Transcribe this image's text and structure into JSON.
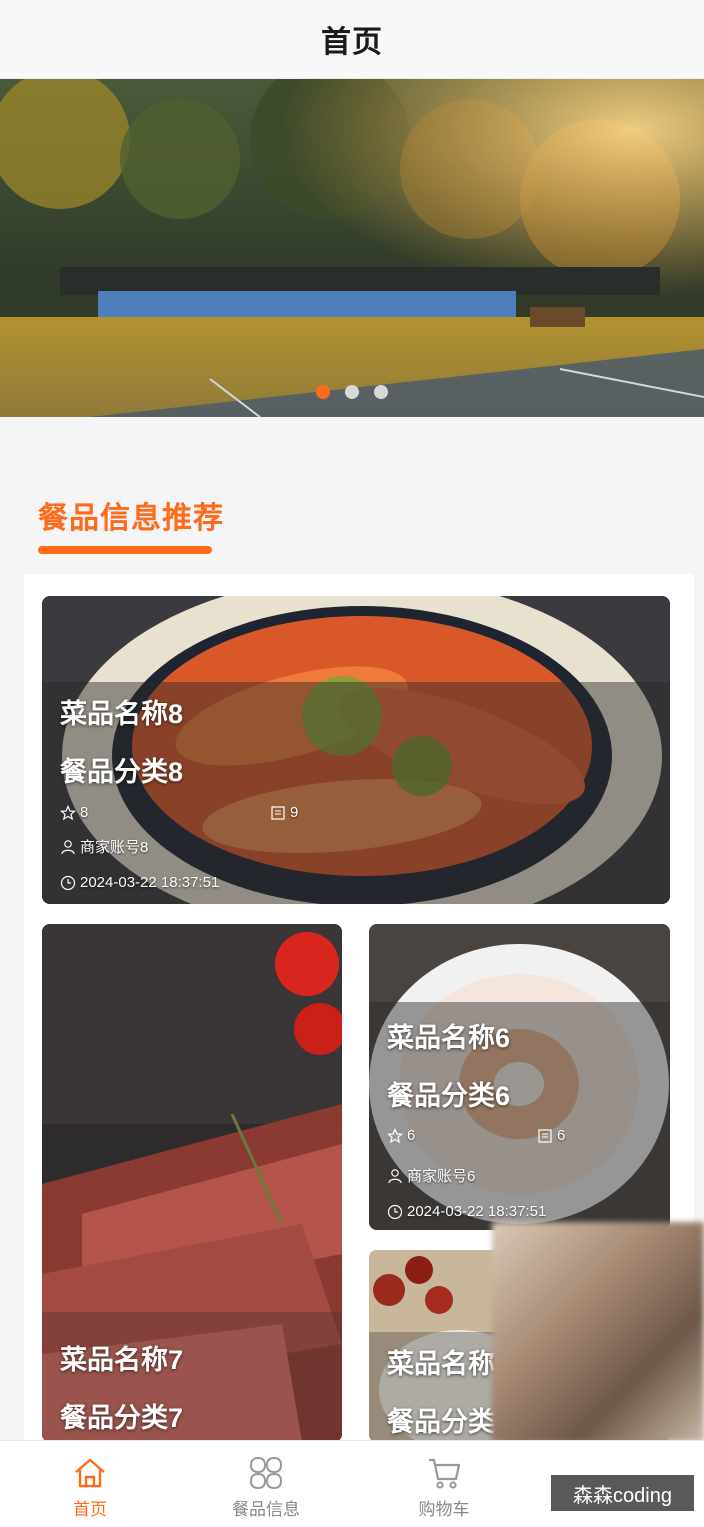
{
  "header": {
    "title": "首页"
  },
  "banner": {
    "dots": 3,
    "active_index": 0
  },
  "section": {
    "title": "餐品信息推荐"
  },
  "colors": {
    "accent": "#ff6b1a",
    "tab_inactive": "#888888"
  },
  "cards": [
    {
      "name": "菜品名称8",
      "category": "餐品分类8",
      "likes": "8",
      "collects": "9",
      "merchant": "商家账号8",
      "time": "2024-03-22 18:37:51"
    },
    {
      "name": "菜品名称7",
      "category": "餐品分类7"
    },
    {
      "name": "菜品名称6",
      "category": "餐品分类6",
      "likes": "6",
      "collects": "6",
      "merchant": "商家账号6",
      "time": "2024-03-22 18:37:51"
    },
    {
      "name": "菜品名称",
      "category": "餐品分类"
    }
  ],
  "tabbar": {
    "items": [
      {
        "label": "首页",
        "icon": "home-icon",
        "active": true
      },
      {
        "label": "餐品信息",
        "icon": "grid-icon",
        "active": false
      },
      {
        "label": "购物车",
        "icon": "cart-icon",
        "active": false
      }
    ]
  },
  "watermark": "森森coding"
}
